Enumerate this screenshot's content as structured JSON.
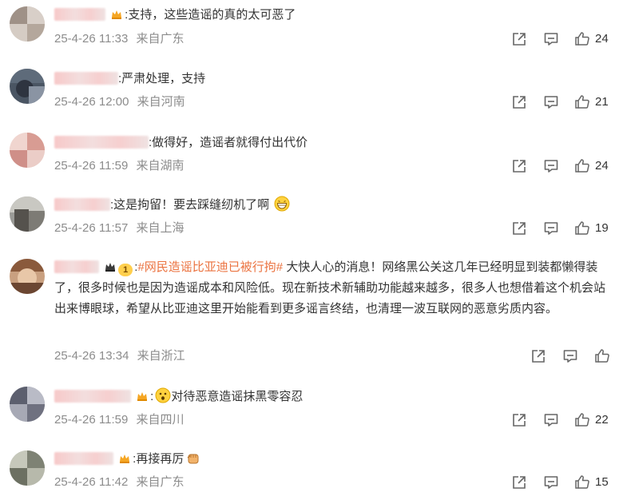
{
  "comments": [
    {
      "text": ":支持，这些造谣的真的太可恶了",
      "date": "25-4-26 11:33",
      "location": "来自广东",
      "likes": "24"
    },
    {
      "text": ":严肃处理，支持",
      "date": "25-4-26 12:00",
      "location": "来自河南",
      "likes": "21"
    },
    {
      "text": ":做得好，造谣者就得付出代价",
      "date": "25-4-26 11:59",
      "location": "来自湖南",
      "likes": "24"
    },
    {
      "text": ":这是拘留！要去踩缝纫机了啊",
      "date": "25-4-26 11:57",
      "location": "来自上海",
      "likes": "19"
    },
    {
      "topic": "#网民造谣比亚迪已被行拘#",
      "level": "1",
      "text": "大快人心的消息！网络黑公关这几年已经明显到装都懒得装了，很多时候也是因为造谣成本和风险低。现在新技术新辅助功能越来越多，很多人也想借着这个机会站出来博眼球，希望从比亚迪这里开始能看到更多谣言终结，也清理一波互联网的恶意劣质内容。",
      "date": "25-4-26 13:34",
      "location": "来自浙江",
      "likes": ""
    },
    {
      "text": "对待恶意造谣抹黑零容忍",
      "date": "25-4-26 11:59",
      "location": "来自四川",
      "likes": "22"
    },
    {
      "text": ":再接再厉",
      "date": "25-4-26 11:42",
      "location": "来自广东",
      "likes": "15"
    }
  ],
  "colors": {
    "topic": "#eb7340",
    "meta": "#8c8c8c",
    "text": "#333333",
    "icon": "#666666"
  },
  "icons": [
    "share-icon",
    "comment-icon",
    "like-icon",
    "crown-badge-icon",
    "emoji-grin-icon",
    "emoji-wow-icon",
    "emoji-fist-icon"
  ]
}
